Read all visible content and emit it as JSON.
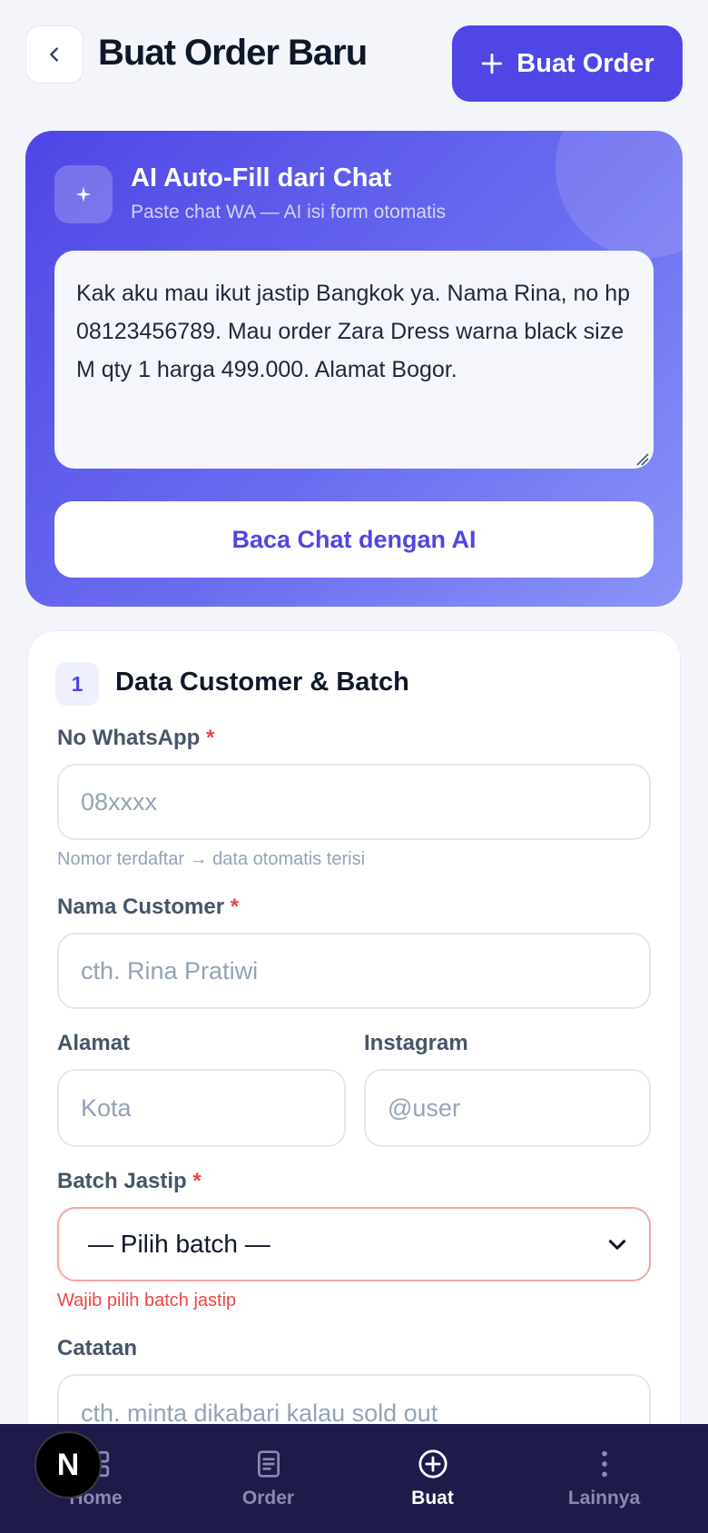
{
  "header": {
    "title": "Buat Order Baru",
    "create_button_label": "Buat Order"
  },
  "ai_card": {
    "title": "AI Auto-Fill dari Chat",
    "subtitle": "Paste chat WA — AI isi form otomatis",
    "chat_text": "Kak aku mau ikut jastip Bangkok ya. Nama Rina, no hp 08123456789. Mau order Zara Dress warna black size M qty 1 harga 499.000. Alamat Bogor.",
    "read_button_label": "Baca Chat dengan AI"
  },
  "form": {
    "step_number": "1",
    "section_title": "Data Customer & Batch",
    "required_mark": "*",
    "whatsapp": {
      "label": "No WhatsApp",
      "placeholder": "08xxxx",
      "hint": "Nomor terdaftar → data otomatis terisi"
    },
    "name": {
      "label": "Nama Customer",
      "placeholder": "cth. Rina Pratiwi"
    },
    "address": {
      "label": "Alamat",
      "placeholder": "Kota"
    },
    "instagram": {
      "label": "Instagram",
      "placeholder": "@user"
    },
    "batch": {
      "label": "Batch Jastip",
      "selected": "— Pilih batch —",
      "error": "Wajib pilih batch jastip"
    },
    "notes": {
      "label": "Catatan",
      "placeholder": "cth. minta dikabari kalau sold out"
    }
  },
  "bottom_nav": {
    "items": [
      {
        "label": "Home",
        "icon": "grid-icon",
        "active": false
      },
      {
        "label": "Order",
        "icon": "document-icon",
        "active": false
      },
      {
        "label": "Buat",
        "icon": "plus-circle-icon",
        "active": true
      },
      {
        "label": "Lainnya",
        "icon": "more-vertical-icon",
        "active": false
      }
    ]
  },
  "dev_badge": {
    "letter": "N"
  },
  "colors": {
    "primary": "#4f46e5",
    "background": "#f3f5fa",
    "nav_background": "#1e1b4b",
    "error": "#ef4444"
  }
}
